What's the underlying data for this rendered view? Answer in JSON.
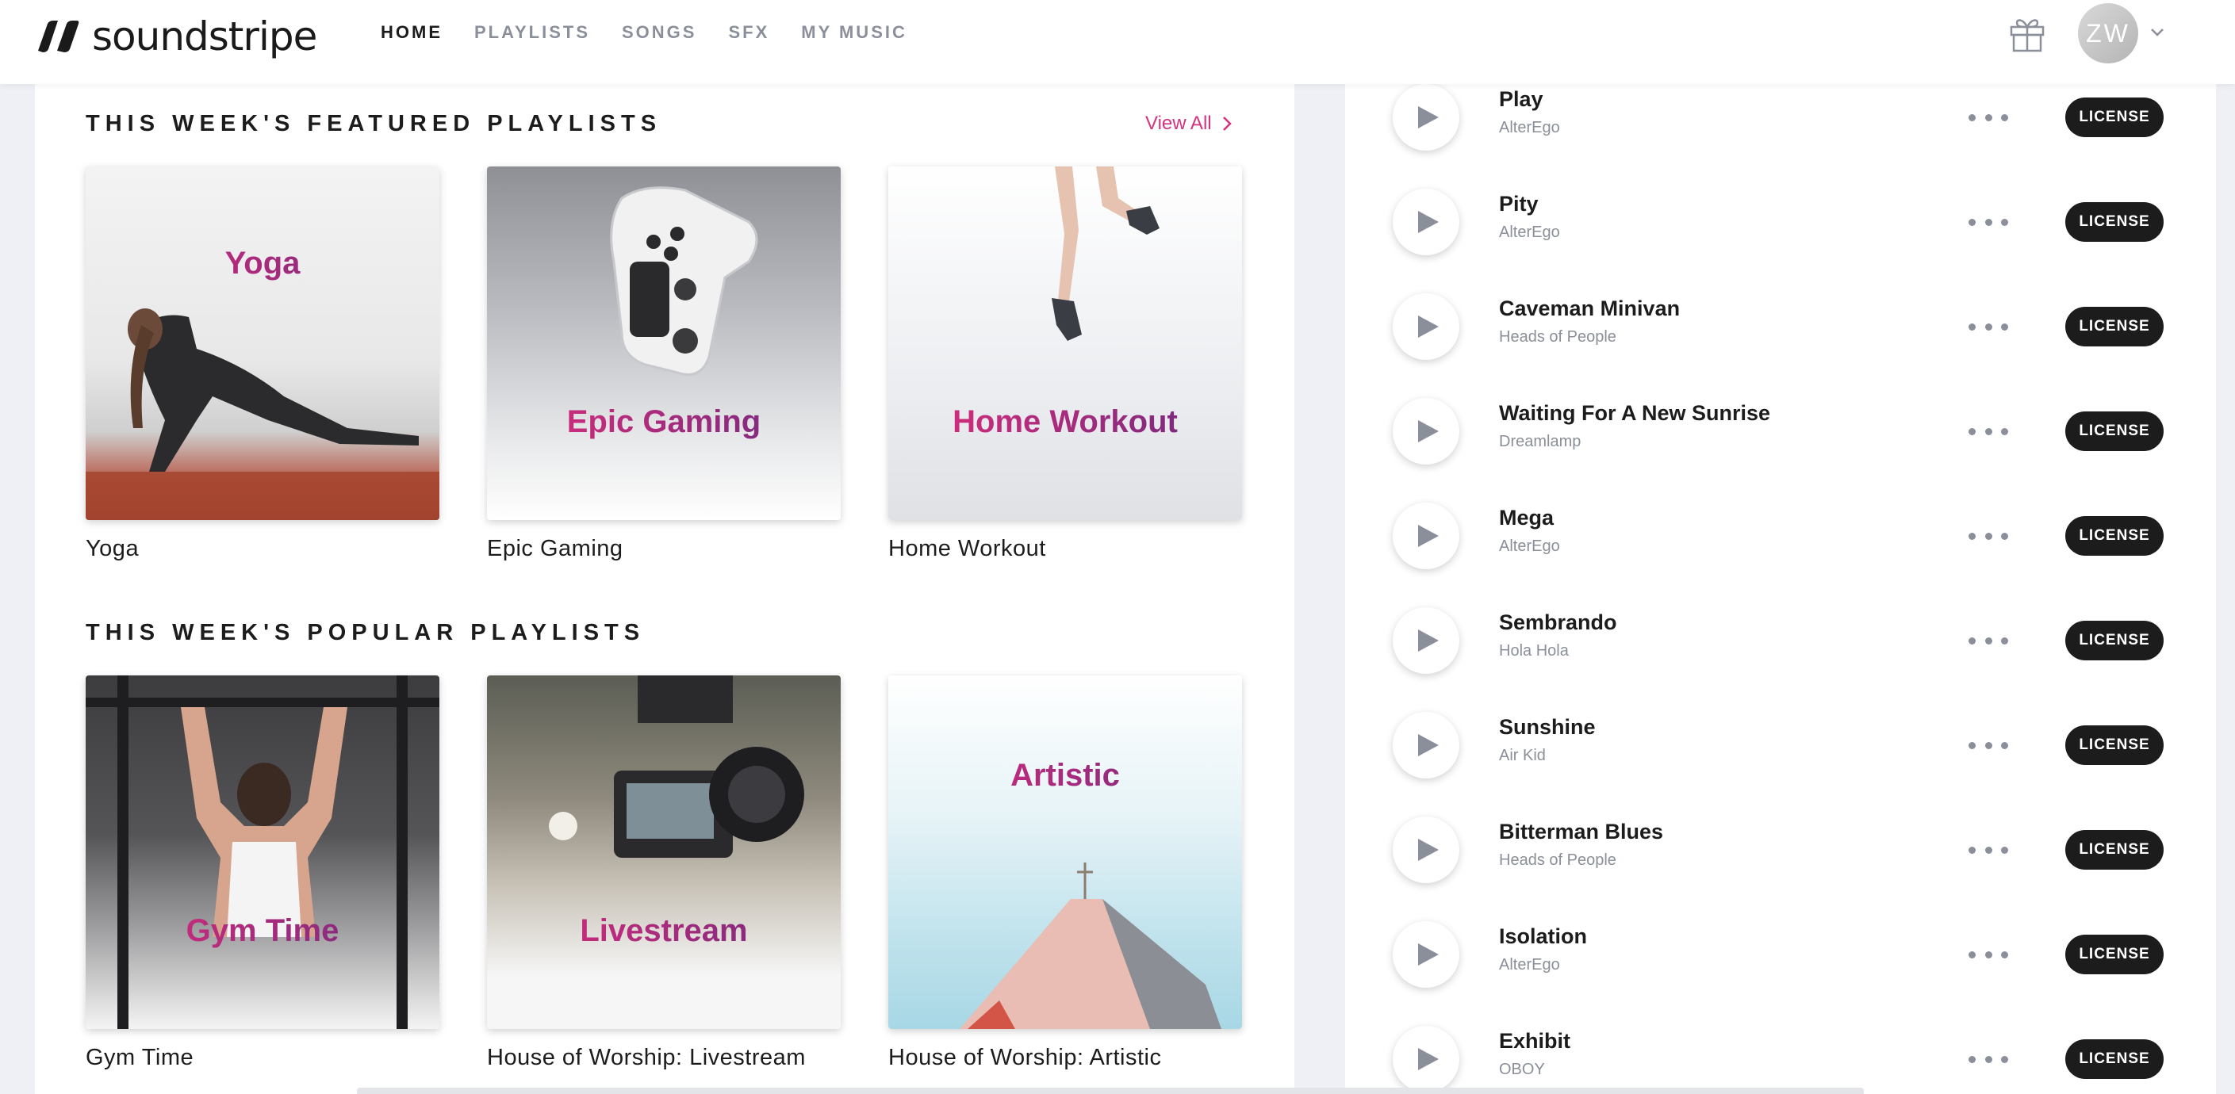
{
  "brand": {
    "name": "soundstripe"
  },
  "nav": {
    "items": [
      {
        "label": "HOME",
        "active": true
      },
      {
        "label": "PLAYLISTS",
        "active": false
      },
      {
        "label": "SONGS",
        "active": false
      },
      {
        "label": "SFX",
        "active": false
      },
      {
        "label": "MY MUSIC",
        "active": false
      }
    ]
  },
  "user": {
    "initials": "ZW"
  },
  "featured": {
    "title": "THIS WEEK'S FEATURED PLAYLISTS",
    "view_all": "View All",
    "cards": [
      {
        "overlay": "Yoga",
        "caption": "Yoga"
      },
      {
        "overlay": "Epic Gaming",
        "caption": "Epic Gaming"
      },
      {
        "overlay": "Home Workout",
        "caption": "Home Workout"
      }
    ]
  },
  "popular": {
    "title": "THIS WEEK'S POPULAR PLAYLISTS",
    "cards": [
      {
        "overlay": "Gym Time",
        "caption": "Gym Time"
      },
      {
        "overlay": "Livestream",
        "caption": "House of Worship: Livestream"
      },
      {
        "overlay": "Artistic",
        "caption": "House of Worship: Artistic"
      }
    ]
  },
  "songs": {
    "license_label": "LICENSE",
    "items": [
      {
        "title": "Play",
        "artist": "AlterEgo"
      },
      {
        "title": "Pity",
        "artist": "AlterEgo"
      },
      {
        "title": "Caveman Minivan",
        "artist": "Heads of People"
      },
      {
        "title": "Waiting For A New Sunrise",
        "artist": "Dreamlamp"
      },
      {
        "title": "Mega",
        "artist": "AlterEgo"
      },
      {
        "title": "Sembrando",
        "artist": "Hola Hola"
      },
      {
        "title": "Sunshine",
        "artist": "Air Kid"
      },
      {
        "title": "Bitterman Blues",
        "artist": "Heads of People"
      },
      {
        "title": "Isolation",
        "artist": "AlterEgo"
      },
      {
        "title": "Exhibit",
        "artist": "OBOY"
      }
    ]
  },
  "colors": {
    "accent": "#d33380",
    "gradient_start": "#e32c7c",
    "gradient_end": "#6c2a7e",
    "license_bg": "#1c1c1c"
  },
  "icons": {
    "gift": "gift-icon",
    "chevron": "chevron-down-icon",
    "play": "play-icon",
    "more": "more-icon"
  }
}
